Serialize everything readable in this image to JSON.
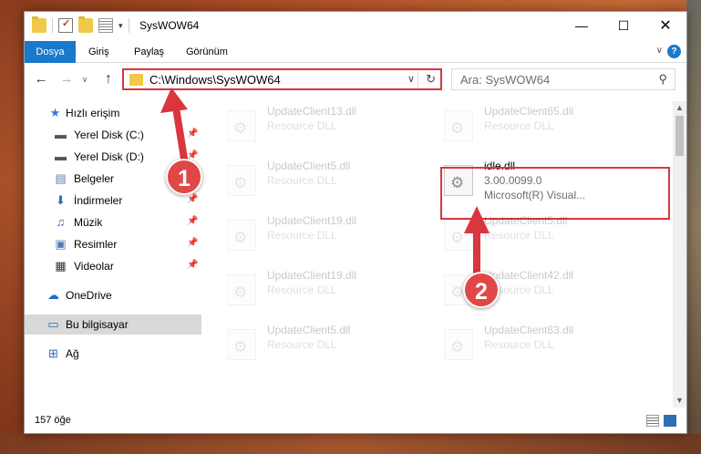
{
  "window": {
    "title": "SysWOW64",
    "minimize_glyph": "—",
    "maximize_glyph": "☐",
    "close_glyph": "✕"
  },
  "quick_access": {
    "dropdown_glyph": "▾"
  },
  "ribbon": {
    "tabs": [
      "Dosya",
      "Giriş",
      "Paylaş",
      "Görünüm"
    ],
    "toggle_glyph": "∨",
    "help_glyph": "?"
  },
  "navigation": {
    "back_glyph": "←",
    "forward_glyph": "→",
    "recent_glyph": "∨",
    "up_glyph": "↑",
    "address": "C:\\Windows\\SysWOW64",
    "address_dropdown_glyph": "∨",
    "refresh_glyph": "↻",
    "search_placeholder": "Ara: SysWOW64",
    "search_glyph": "⚲"
  },
  "sidebar": {
    "items": [
      {
        "label": "Hızlı erişim",
        "icon": "star-icon",
        "glyph": "★",
        "color": "#3a7bd5"
      },
      {
        "label": "Yerel Disk (C:)",
        "icon": "drive-icon",
        "glyph": "▬",
        "color": "#555555"
      },
      {
        "label": "Yerel Disk (D:)",
        "icon": "drive-icon",
        "glyph": "▬",
        "color": "#555555"
      },
      {
        "label": "Belgeler",
        "icon": "documents-icon",
        "glyph": "▤",
        "color": "#5b7db1"
      },
      {
        "label": "İndirmeler",
        "icon": "download-icon",
        "glyph": "⬇",
        "color": "#2f6db5"
      },
      {
        "label": "Müzik",
        "icon": "music-icon",
        "glyph": "♫",
        "color": "#2f6db5"
      },
      {
        "label": "Resimler",
        "icon": "pictures-icon",
        "glyph": "▣",
        "color": "#4d7ab8"
      },
      {
        "label": "Videolar",
        "icon": "video-icon",
        "glyph": "▦",
        "color": "#333333"
      },
      {
        "label": "OneDrive",
        "icon": "cloud-icon",
        "glyph": "☁",
        "color": "#1e6ec8"
      },
      {
        "label": "Bu bilgisayar",
        "icon": "computer-icon",
        "glyph": "▭",
        "color": "#2f6db5"
      },
      {
        "label": "Ağ",
        "icon": "network-icon",
        "glyph": "⊞",
        "color": "#2f6db5"
      }
    ],
    "pin_glyph": "📌"
  },
  "files": [
    {
      "name": "UpdateClient13.dll",
      "desc": "Resource DLL"
    },
    {
      "name": "UpdateClient65.dll",
      "desc": "Resource DLL"
    },
    {
      "name": "UpdateClient5.dll",
      "desc": "Resource DLL"
    },
    {
      "name": "idle.dll",
      "desc": "3.00.0099.0",
      "sub": "Microsoft(R) Visual..."
    },
    {
      "name": "UpdateClient19.dll",
      "desc": "Resource DLL"
    },
    {
      "name": "UpdateClient5.dll",
      "desc": "Resource DLL"
    },
    {
      "name": "UpdateClient19.dll",
      "desc": "Resource DLL"
    },
    {
      "name": "UpdateClient42.dll",
      "desc": "Resource DLL"
    },
    {
      "name": "UpdateClient5.dll",
      "desc": "Resource DLL"
    },
    {
      "name": "UpdateClient63.dll",
      "desc": "Resource DLL"
    }
  ],
  "status": {
    "count": "157 öğe"
  },
  "annotations": {
    "step1": "1",
    "step2": "2",
    "color": "#d9363e"
  }
}
